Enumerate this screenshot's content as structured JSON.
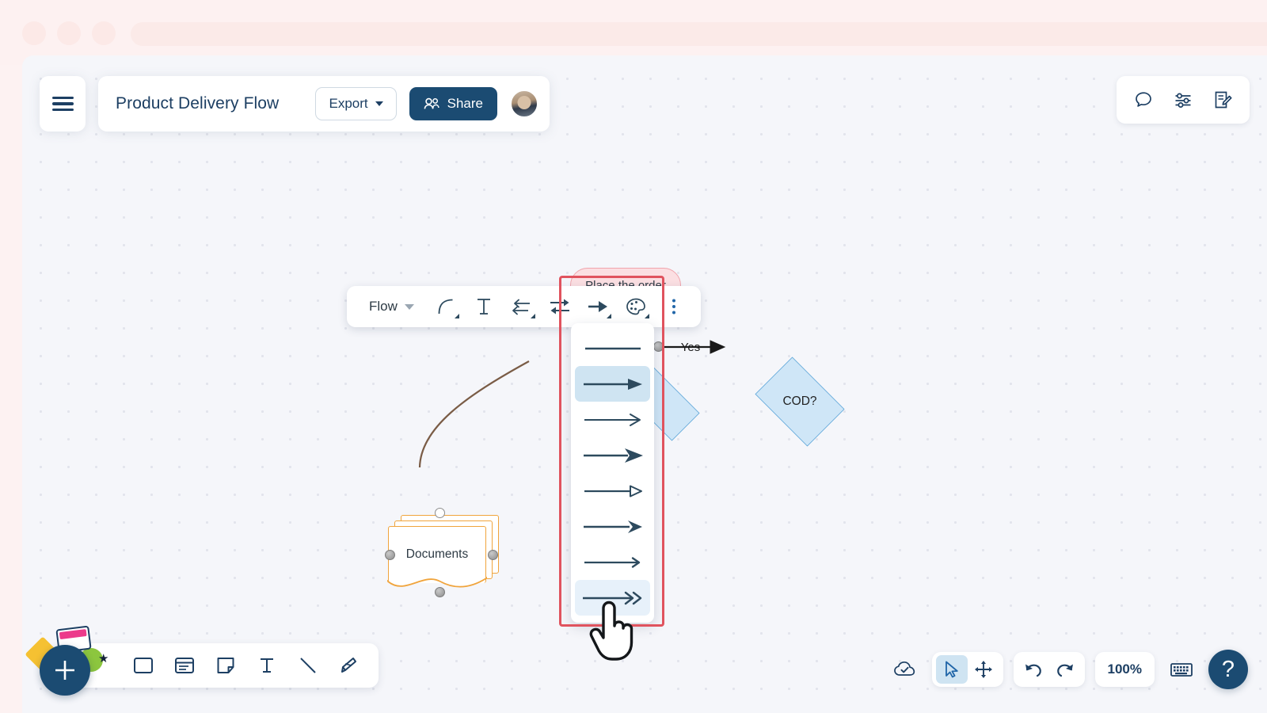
{
  "window": {
    "chrome_dots": [
      "minimize-dot",
      "maximize-dot",
      "close-dot"
    ],
    "url_bar_value": ""
  },
  "header": {
    "menu_icon": "hamburger-icon",
    "doc_title": "Product Delivery Flow",
    "export_label": "Export",
    "export_caret": "chevron-down-icon",
    "share_label": "Share",
    "share_icon": "people-icon",
    "avatar": "user-avatar"
  },
  "topright": {
    "items": [
      {
        "name": "comment-icon",
        "label": "Comments"
      },
      {
        "name": "settings-sliders-icon",
        "label": "Settings"
      },
      {
        "name": "edit-document-icon",
        "label": "Notes"
      }
    ]
  },
  "edge_toolbar": {
    "shape_label": "Flow",
    "shape_caret": "chevron-down-icon",
    "items": [
      {
        "name": "curve-style-icon",
        "label": "Curve style"
      },
      {
        "name": "text-icon",
        "label": "Text"
      },
      {
        "name": "line-style-icon",
        "label": "Line style"
      },
      {
        "name": "line-direction-icon",
        "label": "Direction"
      },
      {
        "name": "arrowhead-icon",
        "label": "Arrowhead"
      },
      {
        "name": "palette-icon",
        "label": "Color"
      },
      {
        "name": "more-options-icon",
        "label": "More"
      }
    ]
  },
  "arrowhead_menu": {
    "options": [
      {
        "id": "none",
        "label": "No arrowhead",
        "state": "normal"
      },
      {
        "id": "filled-triangle",
        "label": "Filled triangle",
        "state": "selected"
      },
      {
        "id": "thin-open",
        "label": "Thin open arrow",
        "state": "normal"
      },
      {
        "id": "concave-filled",
        "label": "Concave filled arrow",
        "state": "normal"
      },
      {
        "id": "hollow-triangle",
        "label": "Hollow triangle",
        "state": "normal"
      },
      {
        "id": "stealth",
        "label": "Stealth arrow",
        "state": "normal"
      },
      {
        "id": "open-chevron",
        "label": "Open chevron",
        "state": "normal"
      },
      {
        "id": "double-chevron",
        "label": "Double chevron",
        "state": "hovered"
      }
    ]
  },
  "diagram": {
    "nodes": [
      {
        "id": "place-order",
        "label": "Place the order",
        "shape": "rounded-rectangle",
        "color": "#fbdfe2"
      },
      {
        "id": "cod",
        "label": "COD?",
        "shape": "diamond",
        "color": "#cfe6f7"
      },
      {
        "id": "documents",
        "label": "Documents",
        "shape": "multi-document",
        "color": "#f0a43c"
      }
    ],
    "edge_labels": [
      "Yes"
    ]
  },
  "annotation": {
    "highlight_name": "arrowhead-menu-highlight",
    "highlight_color": "#e0535e",
    "cursor": "pointing-hand-cursor"
  },
  "bottom_left": {
    "add_label": "+",
    "tools": [
      {
        "name": "rectangle-shape-icon",
        "label": "Rectangle"
      },
      {
        "name": "card-shape-icon",
        "label": "Card"
      },
      {
        "name": "sticky-note-icon",
        "label": "Sticky note"
      },
      {
        "name": "text-tool-icon",
        "label": "Text"
      },
      {
        "name": "line-tool-icon",
        "label": "Line"
      },
      {
        "name": "pen-tool-icon",
        "label": "Pen"
      }
    ]
  },
  "bottom_right": {
    "cloud_icon": "cloud-saved-icon",
    "select_icon": "cursor-select-icon",
    "pan_icon": "pan-move-icon",
    "undo_icon": "undo-icon",
    "redo_icon": "redo-icon",
    "zoom_value": "100%",
    "keyboard_icon": "keyboard-shortcuts-icon",
    "help_label": "?"
  }
}
